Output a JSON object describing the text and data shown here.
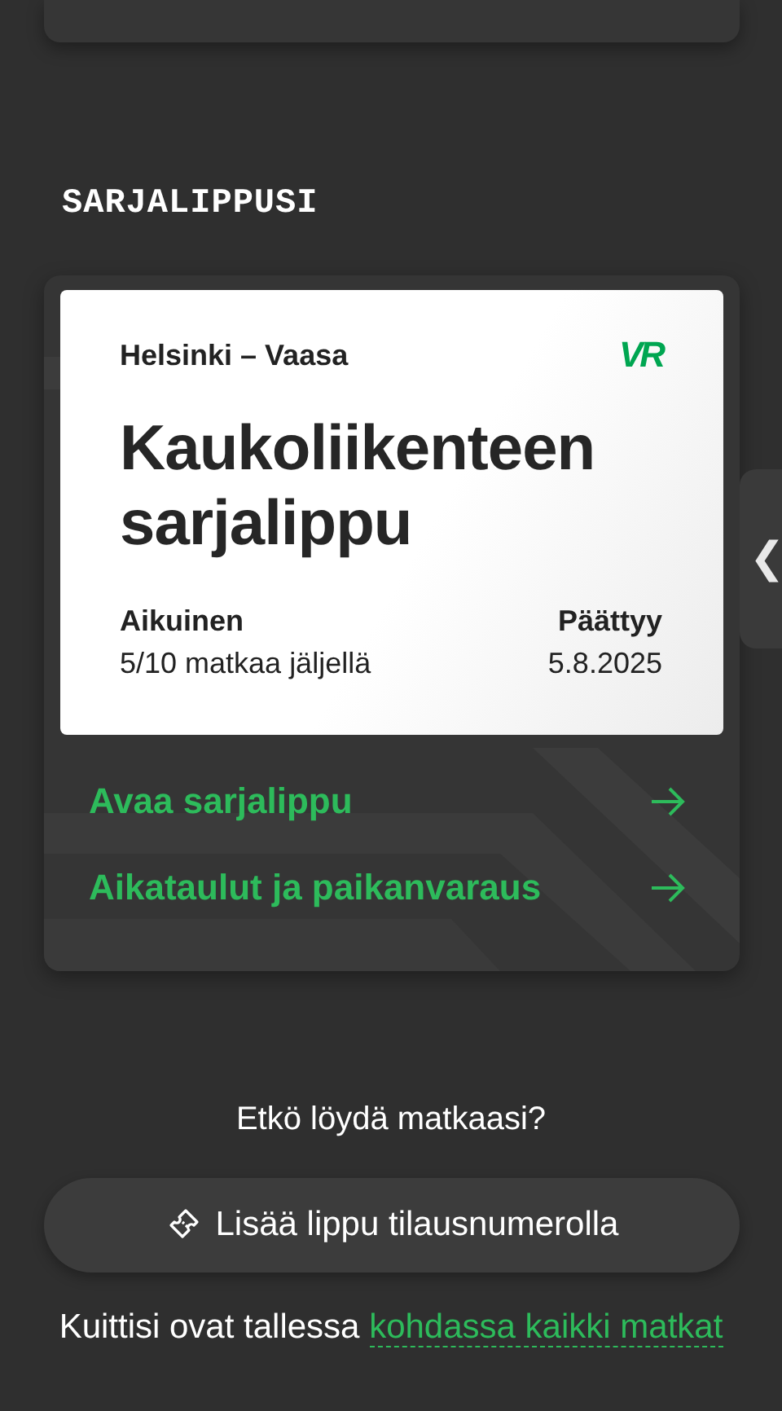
{
  "section_title": "SARJALIPPUSI",
  "ticket": {
    "route": "Helsinki – Vaasa",
    "logo": "VR",
    "title": "Kaukoliikenteen sarjalippu",
    "passenger_label": "Aikuinen",
    "trips_left": "5/10 matkaa jäljellä",
    "expiry_label": "Päättyy",
    "expiry_date": "5.8.2025"
  },
  "links": [
    {
      "label": "Avaa sarjalippu"
    },
    {
      "label": "Aikataulut ja paikanvaraus"
    }
  ],
  "side_tab": {
    "glyph": "❮"
  },
  "help": {
    "question": "Etkö löydä matkaasi?",
    "button": "Lisää lippu tilausnumerolla",
    "note": "Kuittisi ovat tallessa",
    "note_link": "kohdassa kaikki matkat"
  }
}
